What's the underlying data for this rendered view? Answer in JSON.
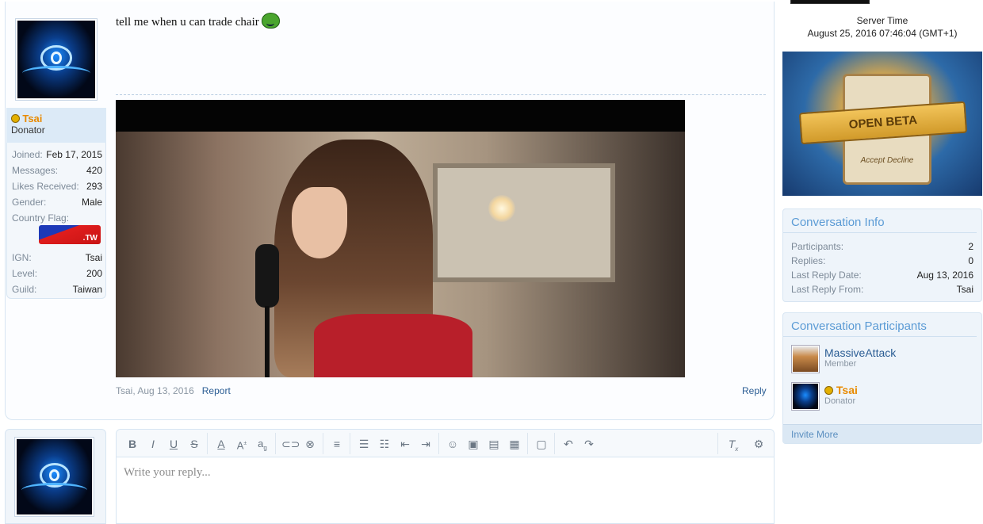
{
  "post": {
    "message": "tell me when u can trade chair",
    "user": {
      "name": "Tsai",
      "title": "Donator",
      "joined_label": "Joined:",
      "joined": "Feb 17, 2015",
      "messages_label": "Messages:",
      "messages": "420",
      "likes_label": "Likes Received:",
      "likes": "293",
      "gender_label": "Gender:",
      "gender": "Male",
      "flag_label": "Country Flag:",
      "flag_text": ".TW",
      "ign_label": "IGN:",
      "ign": "Tsai",
      "level_label": "Level:",
      "level": "200",
      "guild_label": "Guild:",
      "guild": "Taiwan"
    },
    "meta_author_date": "Tsai, Aug 13, 2016",
    "report_label": "Report",
    "reply_label": "Reply"
  },
  "editor": {
    "placeholder": "Write your reply...",
    "tools": [
      "bold",
      "italic",
      "underline",
      "strikethrough",
      "text-color",
      "font-size",
      "font-family",
      "link",
      "unlink",
      "align",
      "bullet-list",
      "numbered-list",
      "outdent",
      "indent",
      "smilies",
      "image",
      "media",
      "quote",
      "save-draft",
      "undo",
      "redo",
      "remove-formatting",
      "toggle-bbcode"
    ]
  },
  "sidebar": {
    "server_time_label": "Server Time",
    "server_time": "August 25, 2016 07:46:04 (GMT+1)",
    "banner_text": "OPEN BETA",
    "banner_sub": "Accept    Decline",
    "conv_info": {
      "title": "Conversation Info",
      "participants_label": "Participants:",
      "participants": "2",
      "replies_label": "Replies:",
      "replies": "0",
      "last_date_label": "Last Reply Date:",
      "last_date": "Aug 13, 2016",
      "last_from_label": "Last Reply From:",
      "last_from": "Tsai"
    },
    "conv_parts": {
      "title": "Conversation Participants",
      "p1_name": "MassiveAttack",
      "p1_role": "Member",
      "p2_name": "Tsai",
      "p2_role": "Donator",
      "invite_label": "Invite More"
    }
  },
  "colors": {
    "accent": "#5b9bd5",
    "link": "#2b5d94",
    "donator": "#e88a00"
  }
}
